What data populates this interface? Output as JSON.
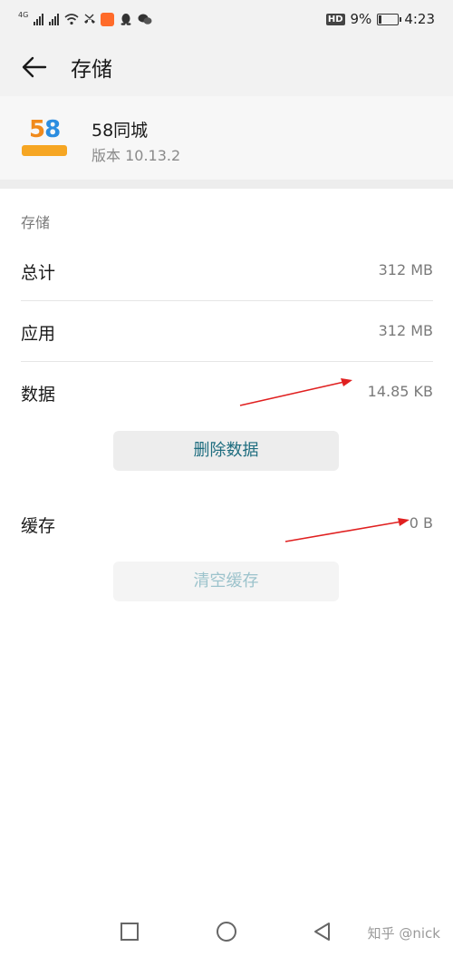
{
  "status_bar": {
    "network": "4G",
    "battery_percent": "9%",
    "time": "4:23",
    "hd_label": "HD",
    "icons": [
      "signal-icon",
      "signal-icon",
      "wifi-icon",
      "missed-call-icon",
      "app-notification-icon",
      "qq-icon",
      "wechat-icon"
    ]
  },
  "header": {
    "back_icon": "arrow-left-icon",
    "title": "存储"
  },
  "app": {
    "name": "58同城",
    "version": "版本 10.13.2",
    "logo_text": "58"
  },
  "storage": {
    "section_title": "存储",
    "rows": [
      {
        "label": "总计",
        "value": "312 MB"
      },
      {
        "label": "应用",
        "value": "312 MB"
      },
      {
        "label": "数据",
        "value": "14.85 KB"
      }
    ],
    "delete_button": "删除数据",
    "cache": {
      "label": "缓存",
      "value": "0 B"
    },
    "clear_cache_button": "清空缓存"
  },
  "annotations": {
    "arrow_color": "#e02020"
  },
  "nav": {
    "icons": [
      "recent-apps-icon",
      "home-icon",
      "back-triangle-icon"
    ]
  },
  "watermark": "知乎 @nick",
  "colors": {
    "accent": "#1e6d7f",
    "accent_disabled": "#9cc3cc"
  }
}
